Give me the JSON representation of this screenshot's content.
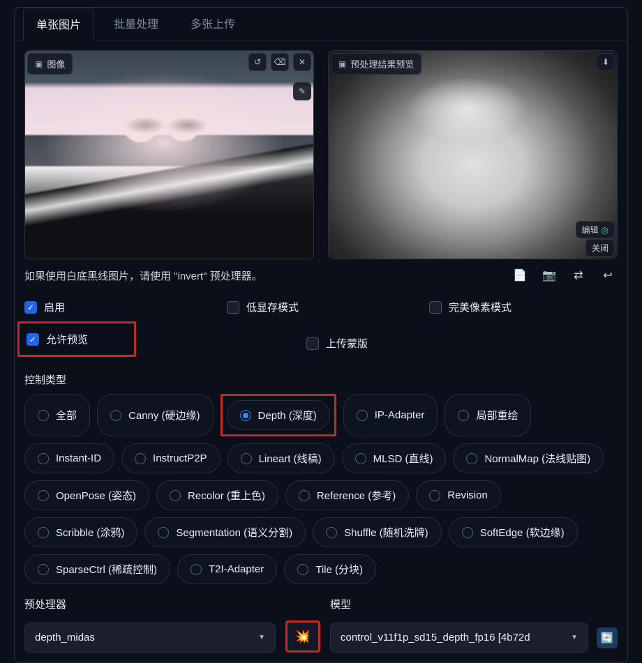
{
  "tabs": {
    "single": "单张图片",
    "batch": "批量处理",
    "multi": "多张上传"
  },
  "image_source": {
    "label": "图像"
  },
  "preprocess_preview": {
    "label": "预处理结果预览"
  },
  "edit": {
    "label": "编辑"
  },
  "close": {
    "label": "关闭"
  },
  "hint_text": "如果使用白底黑线图片，请使用 \"invert\" 预处理器。",
  "checks": {
    "enable": "启用",
    "low_vram": "低显存模式",
    "pixel_perfect": "完美像素模式",
    "allow_preview": "允许预览",
    "upload_mask": "上传蒙版"
  },
  "control_type_label": "控制类型",
  "control_types": [
    "全部",
    "Canny (硬边缘)",
    "Depth (深度)",
    "IP-Adapter",
    "局部重绘",
    "Instant-ID",
    "InstructP2P",
    "Lineart (线稿)",
    "MLSD (直线)",
    "NormalMap (法线贴图)",
    "OpenPose (姿态)",
    "Recolor (重上色)",
    "Reference (参考)",
    "Revision",
    "Scribble (涂鸦)",
    "Segmentation (语义分割)",
    "Shuffle (随机洗牌)",
    "SoftEdge (软边缘)",
    "SparseCtrl (稀疏控制)",
    "T2I-Adapter",
    "Tile (分块)"
  ],
  "control_type_selected": "Depth (深度)",
  "preprocessor": {
    "label": "预处理器",
    "value": "depth_midas"
  },
  "model": {
    "label": "模型",
    "value": "control_v11f1p_sd15_depth_fp16 [4b72d"
  }
}
